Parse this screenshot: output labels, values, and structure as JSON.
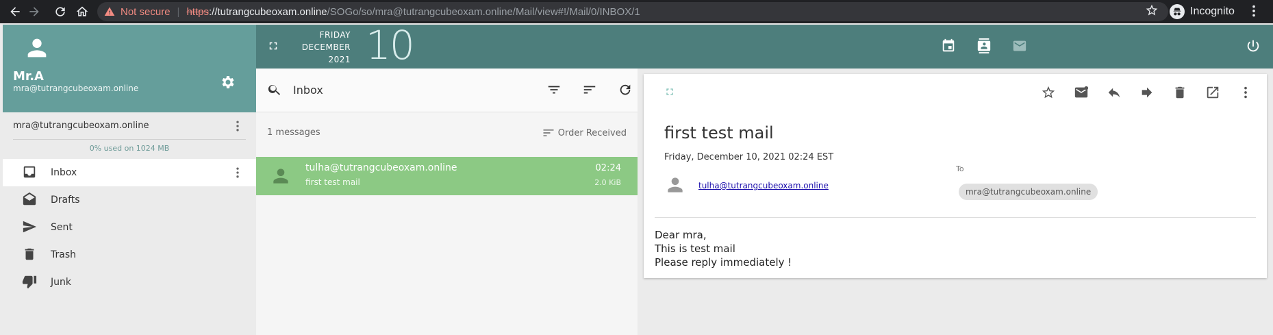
{
  "browser": {
    "not_secure": "Not secure",
    "url_scheme": "https",
    "url_host": "://tutrangcubeoxam.online",
    "url_path": "/SOGo/so/mra@tutrangcubeoxam.online/Mail/view#!/Mail/0/INBOX/1",
    "profile_label": "Incognito"
  },
  "sidebar": {
    "user_name": "Mr.A",
    "user_email": "mra@tutrangcubeoxam.online",
    "account": "mra@tutrangcubeoxam.online",
    "quota": "0% used on 1024 MB",
    "folders": [
      {
        "label": "Inbox",
        "icon": "inbox-icon"
      },
      {
        "label": "Drafts",
        "icon": "drafts-icon"
      },
      {
        "label": "Sent",
        "icon": "send-icon"
      },
      {
        "label": "Trash",
        "icon": "trash-icon"
      },
      {
        "label": "Junk",
        "icon": "junk-icon"
      }
    ]
  },
  "topbar": {
    "weekday": "FRIDAY",
    "month": "DECEMBER",
    "year": "2021",
    "day": "10"
  },
  "list": {
    "title": "Inbox",
    "count": "1 messages",
    "sort_label": "Order Received",
    "messages": [
      {
        "from": "tulha@tutrangcubeoxam.online",
        "subject": "first test mail",
        "time": "02:24",
        "size": "2.0 KiB"
      }
    ]
  },
  "reader": {
    "subject": "first test mail",
    "date": "Friday, December 10, 2021 02:24 EST",
    "to_label": "To",
    "from": "tulha@tutrangcubeoxam.online",
    "to": "mra@tutrangcubeoxam.online",
    "body": [
      "Dear mra,",
      "This is test mail",
      "Please reply immediately !"
    ]
  },
  "colors": {
    "sidebar_header": "#659e9b",
    "topbar": "#4d7e7c",
    "selected_message": "#8cc984"
  }
}
